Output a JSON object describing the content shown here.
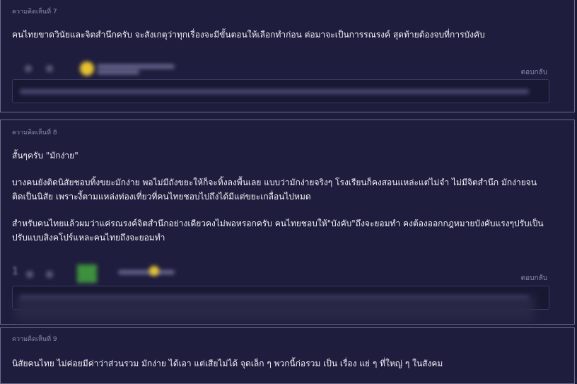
{
  "comments": [
    {
      "label": "ความคิดเห็นที่ 7",
      "paragraphs": [
        "คนไทยขาดวินัยและจิตสำนึกครับ จะสังเกตุว่าทุกเรื่องจะมีขั้นตอนให้เลือกทำก่อน ต่อมาจะเป็นการรณรงค์ สุดท้ายต้องจบที่การบังคับ"
      ],
      "reply_link": "ตอบกลับ"
    },
    {
      "label": "ความคิดเห็นที่ 8",
      "paragraphs": [
        "สั้นๆครับ \"มักง่าย\"",
        "บางคนยังติดนิสัยชอบทิ้งขยะมักง่าย พอไม่มีถังขยะให้ก็จะทิ้งลงพื้นเลย แบบว่ามักง่ายจริงๆ โรงเรียนก็คงสอนแหล่ะแต่ไม่จำ ไม่มีจิตสำนึก มักง่ายจน\nติดเป็นนิสัย เพราะงี้ตามแหล่งท่องเที่ยวที่คนไทยชอบไปถึงได้มีแต่ขยะเกลื่อนไปหมด",
        "สำหรับคนไทยแล้วผมว่าแค่รณรงค์จิตสำนึกอย่างเดียวคงไม่พอหรอกครับ คนไทยชอบให้\"บังคับ\"ถึงจะยอมทำ คงต้องออกกฎหมายบังคับแรงๆปรับเป็น\nปรับแบบสิงคโปร์แหละคนไทยถึงจะยอมทำ"
      ],
      "reply_link": "ตอบกลับ",
      "vote_count": "1"
    },
    {
      "label": "ความคิดเห็นที่ 9",
      "paragraphs": [
        "นิสัยคนไทย ไม่ค่อยมีค่าว่าส่วนรวม มักง่าย ได้เอา แต่เสียไม่ได้ จุดเล็ก ๆ พวกนี้ก่อรวม เป็น เรื่อง แย่ ๆ ที่ใหญ่ ๆ ในสังคม"
      ]
    }
  ]
}
